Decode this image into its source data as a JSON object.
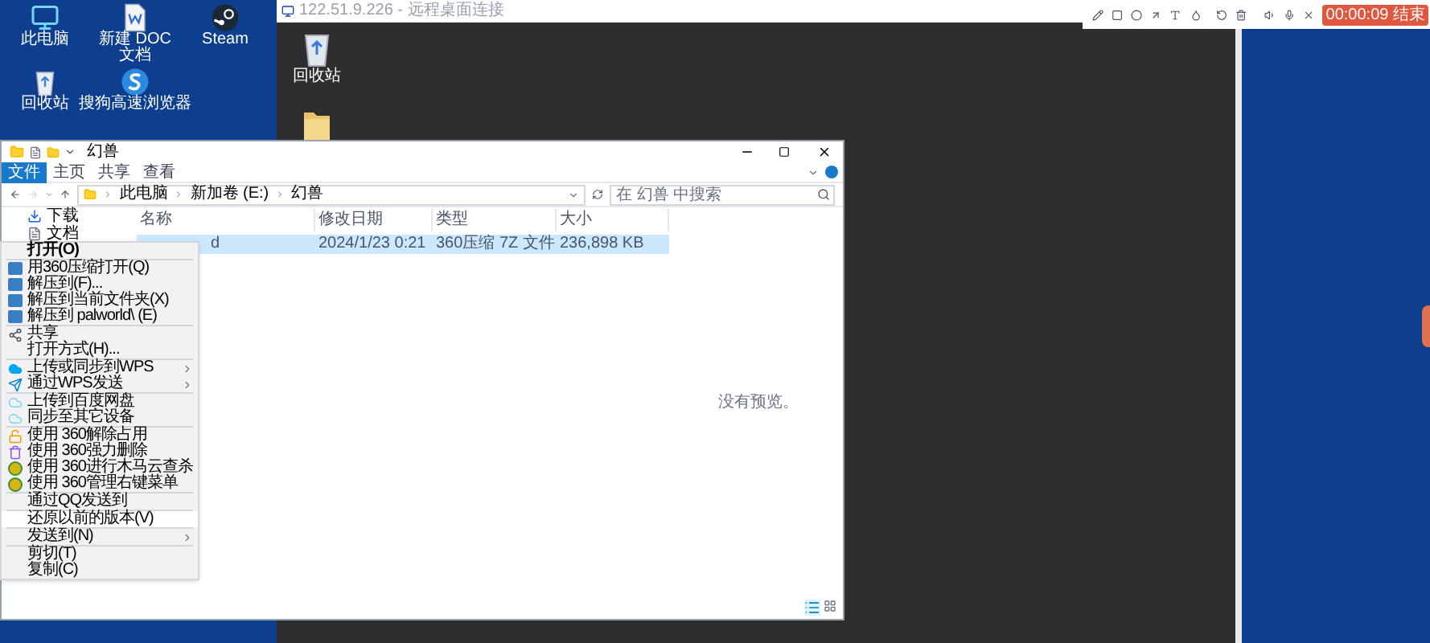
{
  "desktop": {
    "icons": [
      {
        "label": "此电脑",
        "kind": "computer"
      },
      {
        "label": "新建 DOC 文档",
        "kind": "doc"
      },
      {
        "label": "Steam",
        "kind": "steam"
      },
      {
        "label": "回收站",
        "kind": "recycle"
      },
      {
        "label": "搜狗高速浏览器",
        "kind": "browser"
      }
    ]
  },
  "remote_window": {
    "title": "122.51.9.226 - 远程桌面连接",
    "icons": [
      {
        "label": "回收站",
        "kind": "recycle"
      },
      {
        "kind": "folder"
      }
    ]
  },
  "recorder": {
    "timer": "00:00:09 结束"
  },
  "explorer": {
    "title": "幻兽",
    "tabs": [
      {
        "label": "文件",
        "selected": true
      },
      {
        "label": "主页",
        "selected": false
      },
      {
        "label": "共享",
        "selected": false
      },
      {
        "label": "查看",
        "selected": false
      }
    ],
    "breadcrumb": [
      "此电脑",
      "新加卷 (E:)",
      "幻兽"
    ],
    "search": {
      "placeholder": "在 幻兽 中搜索"
    },
    "nav": [
      {
        "label": "下载",
        "kind": "download"
      },
      {
        "label": "文档",
        "kind": "document"
      }
    ],
    "columns": [
      "名称",
      "修改日期",
      "类型",
      "大小"
    ],
    "rows": [
      {
        "cells": [
          "d",
          "2024/1/23 0:21",
          "360压缩 7Z 文件",
          "236,898 KB"
        ],
        "selected": true
      }
    ],
    "preview": "没有预览。"
  },
  "context_menu": {
    "groups": [
      [
        {
          "label": "打开(O)",
          "default": true,
          "submenu": false,
          "selected": false
        }
      ],
      [
        {
          "label": "用360压缩打开(Q)",
          "kind": "archive",
          "default": false,
          "submenu": false,
          "selected": false
        },
        {
          "label": "解压到(F)...",
          "kind": "archive",
          "default": false,
          "submenu": false,
          "selected": false
        },
        {
          "label": "解压到当前文件夹(X)",
          "kind": "archive",
          "default": false,
          "submenu": false,
          "selected": false
        },
        {
          "label": "解压到 palworld\\ (E)",
          "kind": "archive",
          "default": false,
          "submenu": false,
          "selected": false
        }
      ],
      [
        {
          "label": "共享",
          "kind": "share",
          "default": false,
          "submenu": false,
          "selected": false
        },
        {
          "label": "打开方式(H)...",
          "default": false,
          "submenu": false,
          "selected": false
        }
      ],
      [
        {
          "label": "上传或同步到WPS",
          "kind": "cloud",
          "default": false,
          "submenu": true,
          "selected": false
        },
        {
          "label": "通过WPS发送",
          "kind": "send",
          "default": false,
          "submenu": true,
          "selected": false
        }
      ],
      [
        {
          "label": "上传到百度网盘",
          "kind": "baidu",
          "default": false,
          "submenu": false,
          "selected": false
        },
        {
          "label": "同步至其它设备",
          "kind": "baidu",
          "default": false,
          "submenu": false,
          "selected": false
        }
      ],
      [
        {
          "label": "使用 360解除占用",
          "kind": "unlock",
          "default": false,
          "submenu": false,
          "selected": false
        },
        {
          "label": "使用 360强力删除",
          "kind": "delete",
          "default": false,
          "submenu": false,
          "selected": false
        },
        {
          "label": "使用 360进行木马云查杀",
          "kind": "shield",
          "default": false,
          "submenu": false,
          "selected": false
        },
        {
          "label": "使用 360管理右键菜单",
          "kind": "shield",
          "default": false,
          "submenu": false,
          "selected": false
        }
      ],
      [
        {
          "label": "通过QQ发送到",
          "default": false,
          "submenu": false,
          "selected": false
        }
      ],
      [
        {
          "label": "还原以前的版本(V)",
          "default": false,
          "submenu": false,
          "selected": true
        }
      ],
      [
        {
          "label": "发送到(N)",
          "default": false,
          "submenu": true,
          "selected": false
        }
      ],
      [
        {
          "label": "剪切(T)",
          "default": false,
          "submenu": false,
          "selected": false
        },
        {
          "label": "复制(C)",
          "default": false,
          "submenu": false,
          "selected": false
        }
      ]
    ]
  }
}
